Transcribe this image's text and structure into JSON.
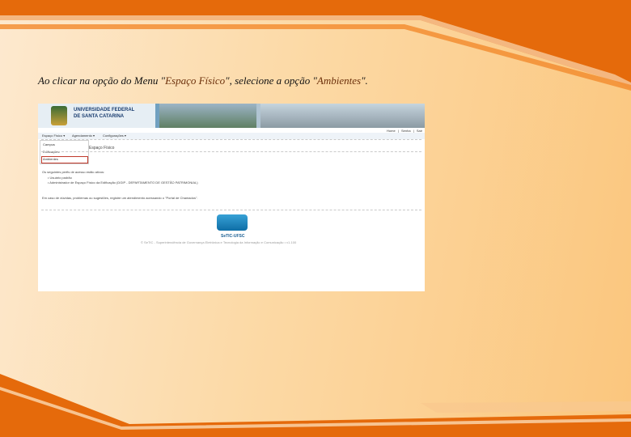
{
  "caption": {
    "prefix": "Ao clicar na opção do Menu \"",
    "menu_item": "Espaço Físico",
    "middle": "\", selecione a opção \"",
    "option": "Ambientes",
    "suffix": "\"."
  },
  "screenshot": {
    "banner": {
      "univ_line1": "UNIVERSIDADE FEDERAL",
      "univ_line2": "DE SANTA CATARINA"
    },
    "top_links": [
      "Home",
      "Senha",
      "Sair"
    ],
    "top_sep": "|",
    "menu": [
      "Espaço Físico ▾",
      "Agendamento ▾",
      "Configurações ▾"
    ],
    "dropdown": [
      "Campus",
      "Edificações",
      "Ambientes"
    ],
    "page_title": "Espaço Físico",
    "intro": "Os seguintes perfis de acesso estão ativos:",
    "profiles": [
      "• Usuário padrão",
      "• Administrador de Espaço Físico da Edificação (DGIP - DEPARTAMENTO DE GESTÃO PATRIMONIAL)"
    ],
    "help": "Em caso de dúvidas, problemas ou sugestões, registre um atendimento acessando o \"Portal de Chamados\".",
    "footer_logo": "SeTIC-UFSC",
    "footer_note": "© SeTIC - Superintendência de Governança Eletrônica e Tecnologia da Informação e Comunicação • v1.100"
  },
  "colors": {
    "orange": "#e36c0a",
    "highlight": "#c0392b"
  }
}
